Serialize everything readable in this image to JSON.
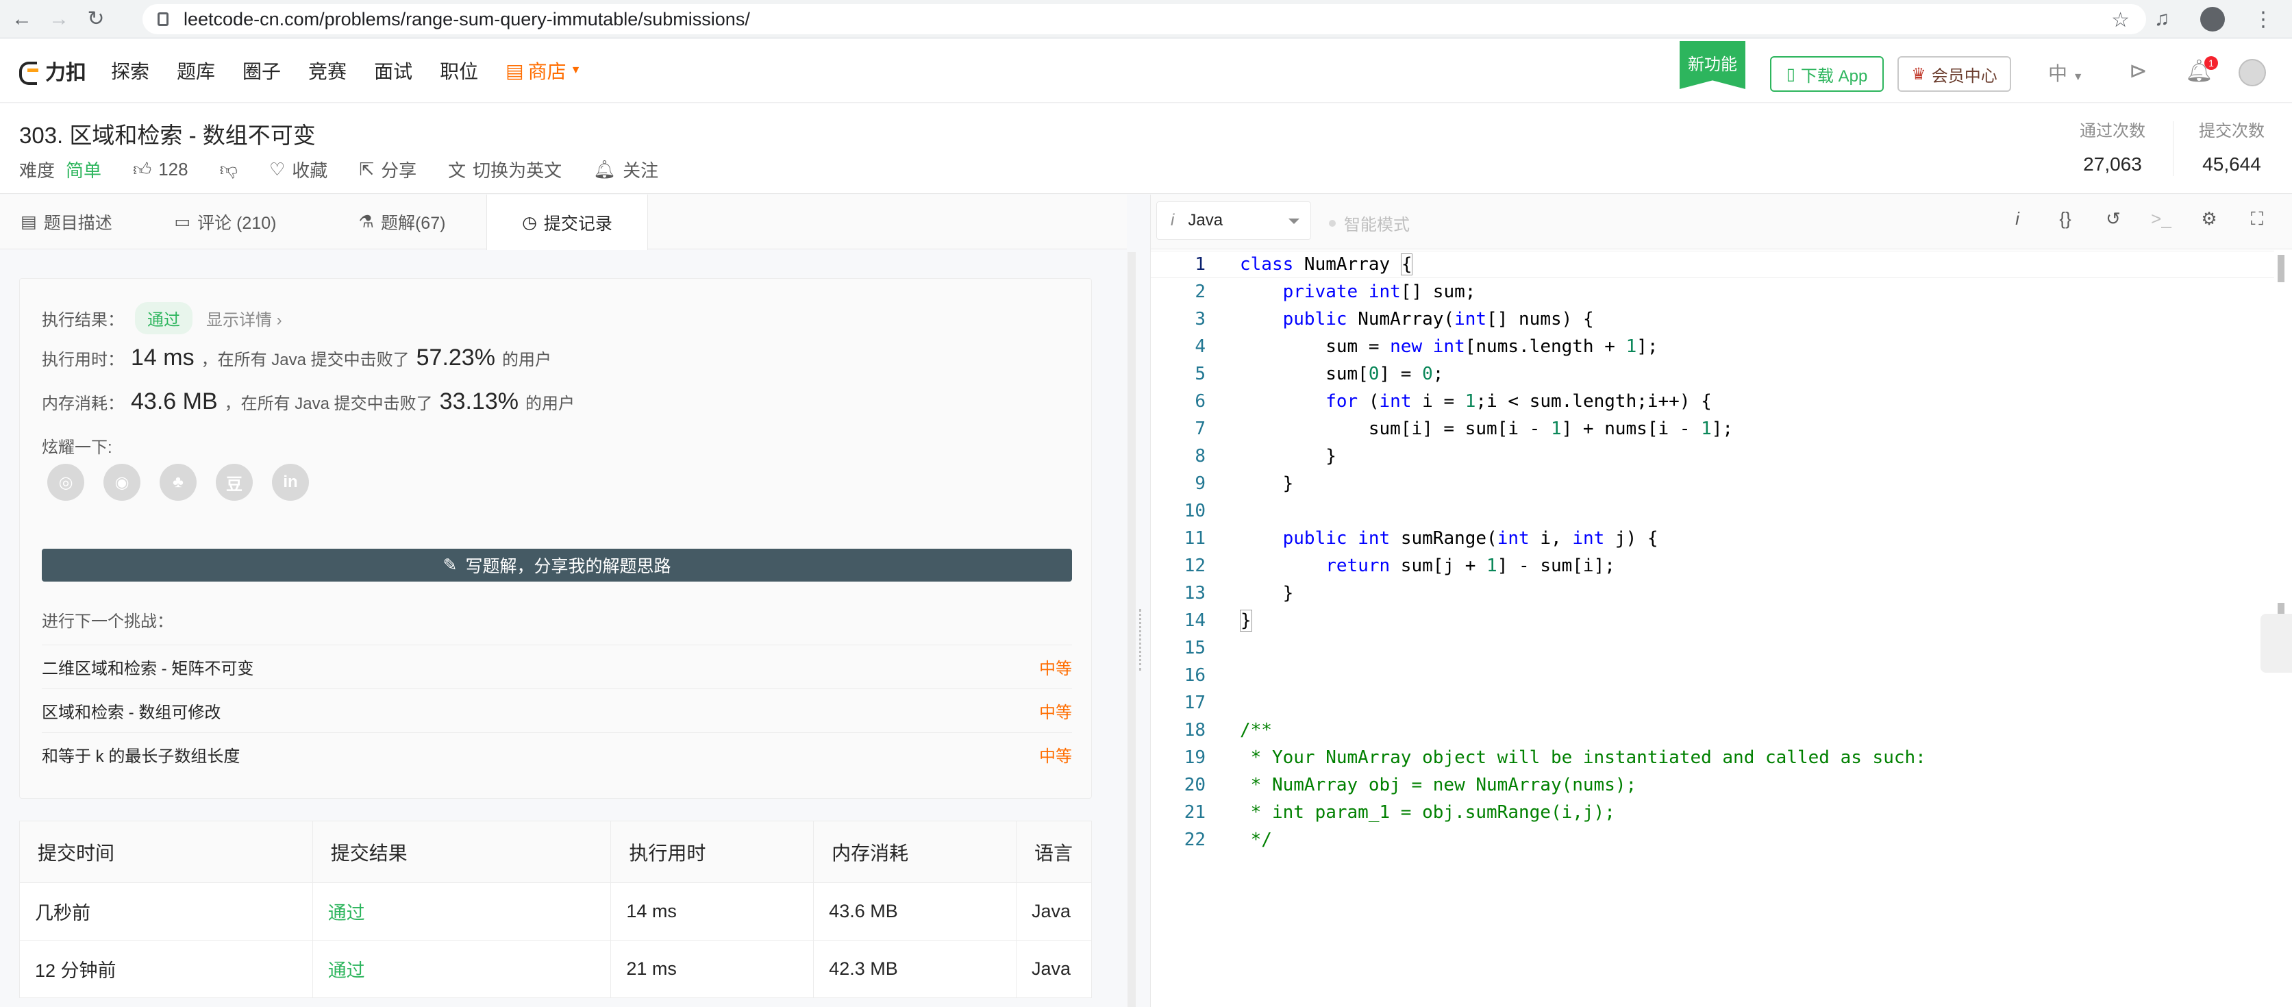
{
  "browser": {
    "url": "leetcode-cn.com/problems/range-sum-query-immutable/submissions/"
  },
  "site": {
    "logo_text": "力扣",
    "nav": [
      "探索",
      "题库",
      "圈子",
      "竞赛",
      "面试",
      "职位"
    ],
    "shop_label": "商店",
    "new_feature": "新功能",
    "download_app": "下载 App",
    "vip_center": "会员中心",
    "lang": "中",
    "notif_count": "1"
  },
  "problem": {
    "title": "303. 区域和检索 - 数组不可变",
    "difficulty_label": "难度",
    "difficulty": "简单",
    "likes": "128",
    "favorite": "收藏",
    "share": "分享",
    "switch_lang": "切换为英文",
    "follow": "关注",
    "accepted_label": "通过次数",
    "accepted": "27,063",
    "submitted_label": "提交次数",
    "submitted": "45,644"
  },
  "tabs": [
    "题目描述",
    "评论 (210)",
    "题解(67)",
    "提交记录"
  ],
  "result": {
    "result_label": "执行结果：",
    "status": "通过",
    "detail": "显示详情 ›",
    "runtime_label": "执行用时：",
    "runtime": "14 ms",
    "runtime_mid": "，在所有 Java 提交中击败了",
    "runtime_pct": "57.23%",
    "runtime_tail": "的用户",
    "memory_label": "内存消耗：",
    "memory": "43.6 MB",
    "memory_mid": "，在所有 Java 提交中击败了",
    "memory_pct": "33.13%",
    "memory_tail": "的用户",
    "share_label": "炫耀一下:",
    "write_solution": "写题解，分享我的解题思路",
    "next_label": "进行下一个挑战：",
    "next": [
      {
        "title": "二维区域和检索 - 矩阵不可变",
        "level": "中等"
      },
      {
        "title": "区域和检索 - 数组可修改",
        "level": "中等"
      },
      {
        "title": "和等于 k 的最长子数组长度",
        "level": "中等"
      }
    ]
  },
  "submissions": {
    "headers": [
      "提交时间",
      "提交结果",
      "执行用时",
      "内存消耗",
      "语言"
    ],
    "rows": [
      [
        "几秒前",
        "通过",
        "14 ms",
        "43.6 MB",
        "Java"
      ],
      [
        "12 分钟前",
        "通过",
        "21 ms",
        "42.3 MB",
        "Java"
      ]
    ]
  },
  "editor": {
    "language": "Java",
    "smart_mode": "智能模式",
    "line_numbers": [
      "1",
      "2",
      "3",
      "4",
      "5",
      "6",
      "7",
      "8",
      "9",
      "10",
      "11",
      "12",
      "13",
      "14",
      "15",
      "16",
      "17",
      "18",
      "19",
      "20",
      "21",
      "22"
    ]
  },
  "colors": {
    "accent_green": "#2db55d",
    "orange": "#ff6d00",
    "keyword": "#0000ff",
    "number": "#098658",
    "comment": "#008000"
  }
}
